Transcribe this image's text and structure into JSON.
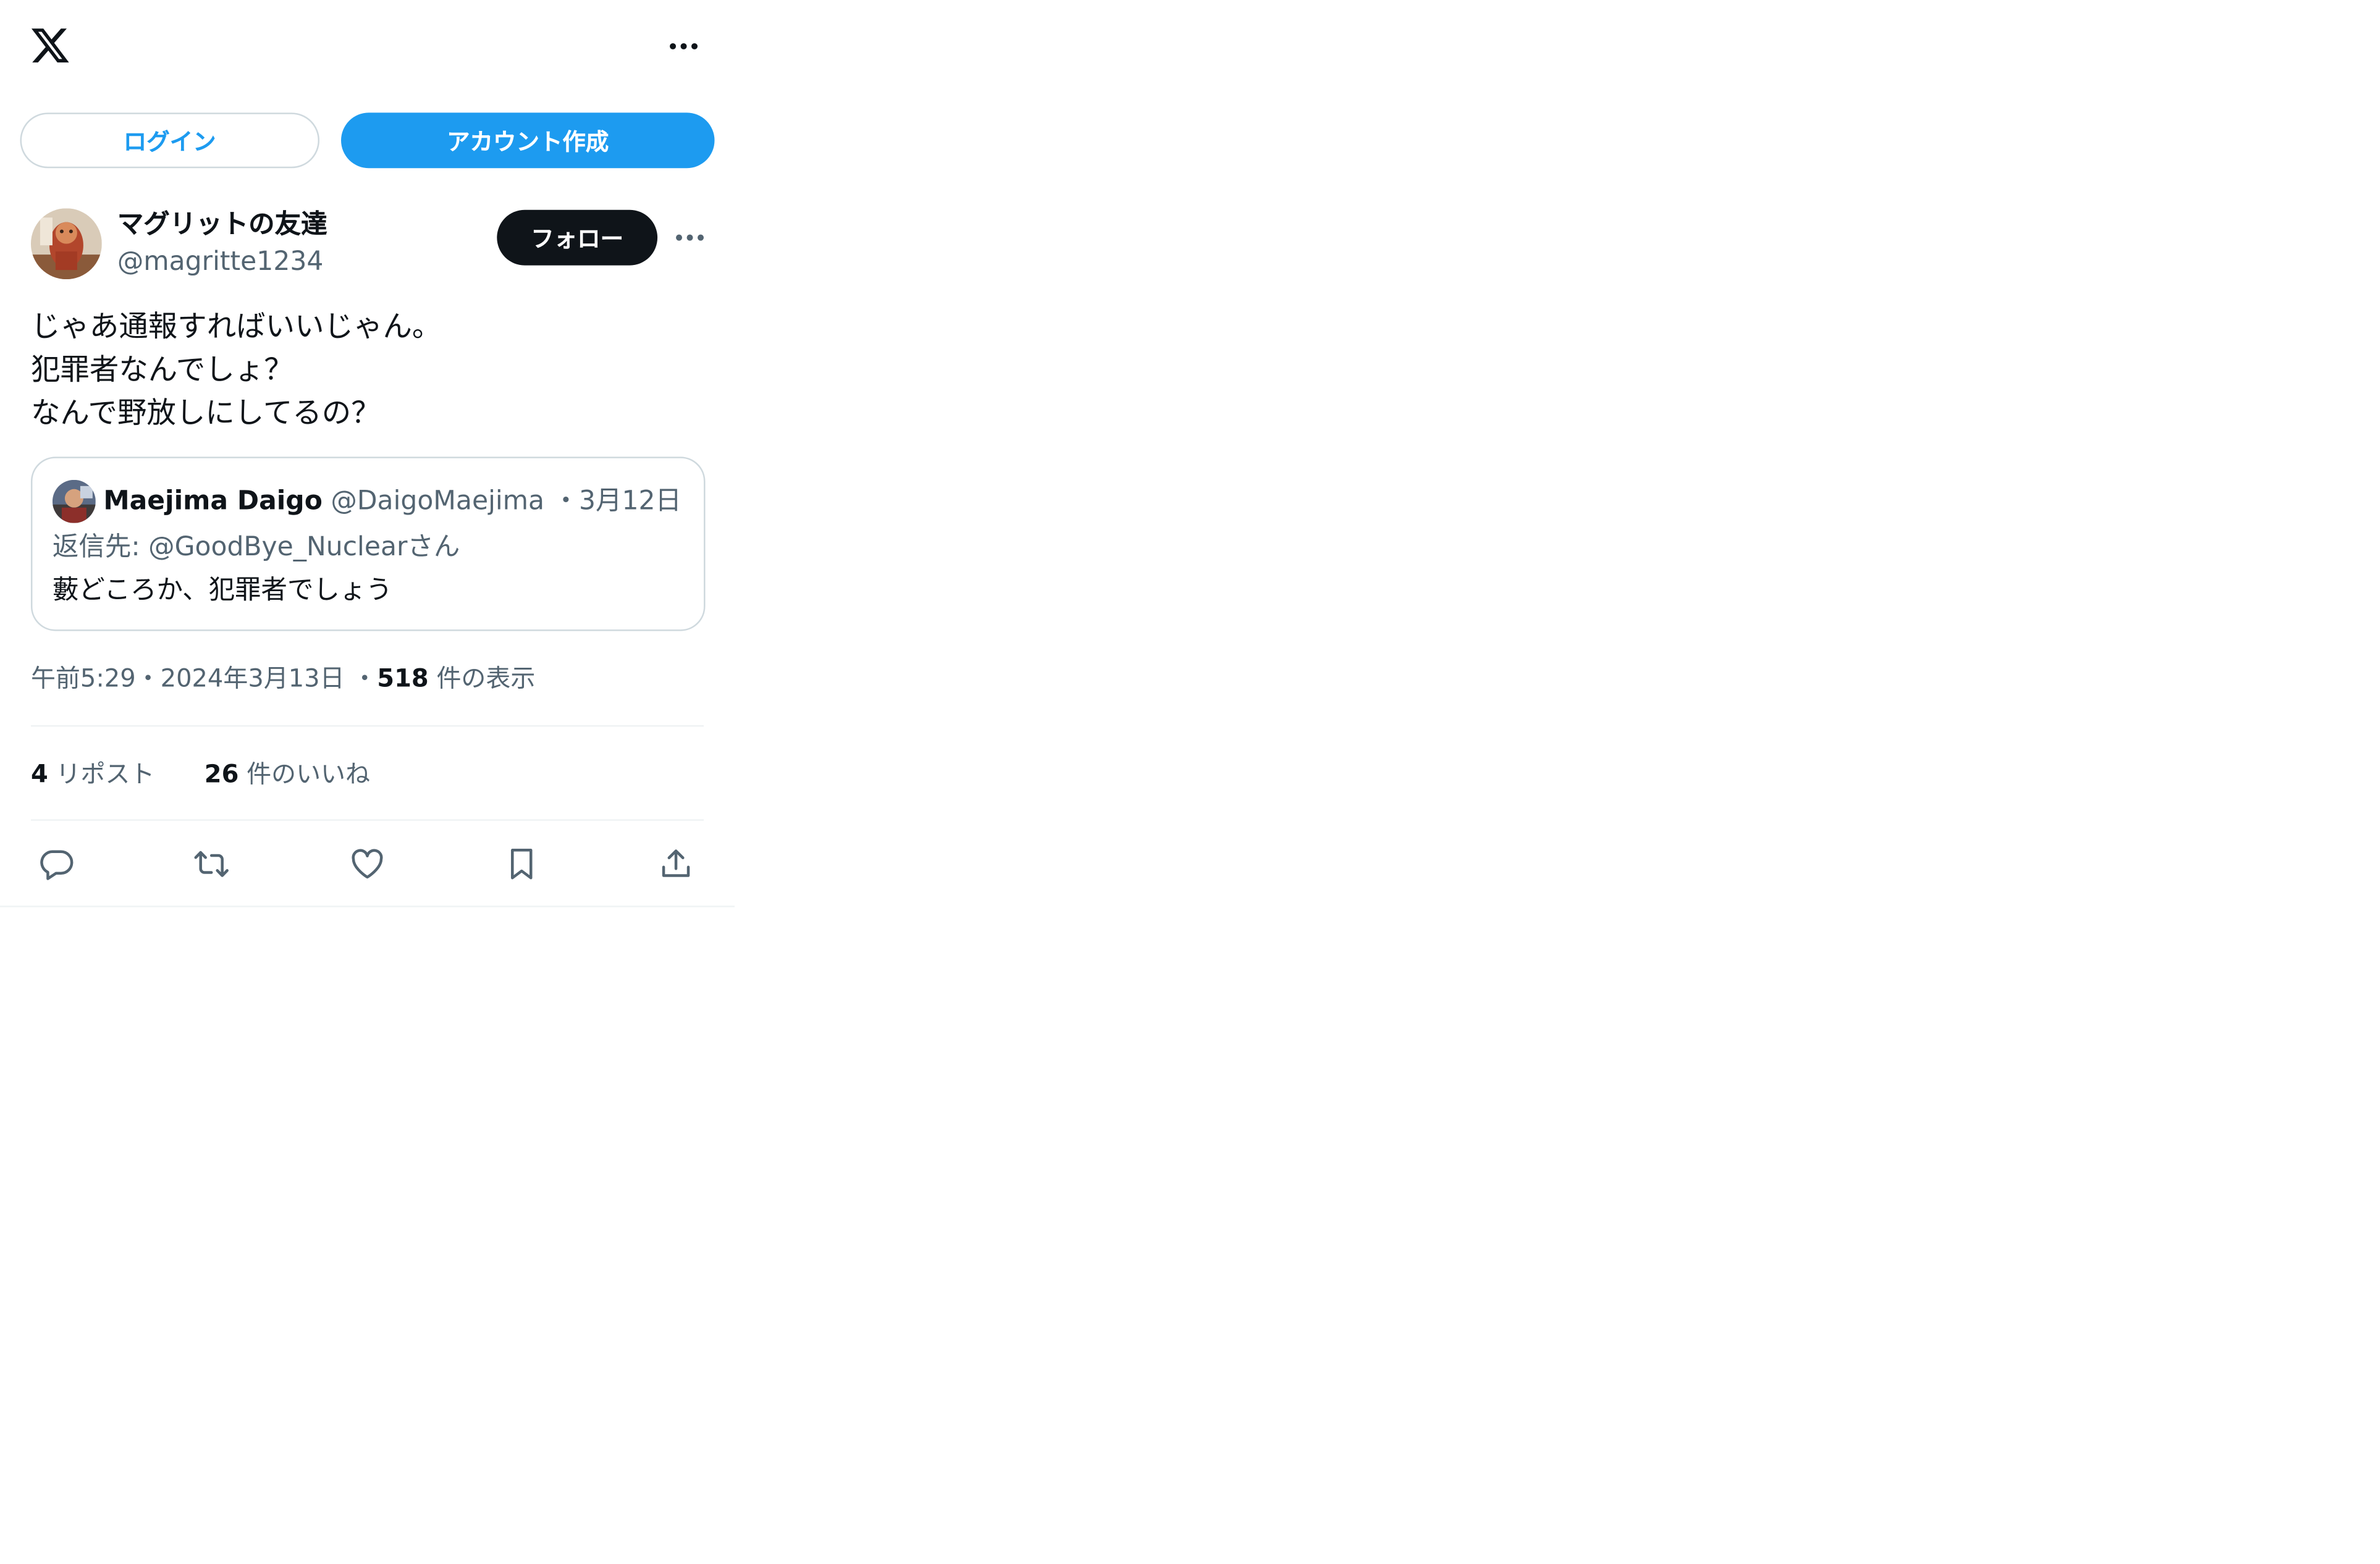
{
  "header": {
    "logo_icon": "x-logo-icon",
    "more_icon": "more-icon"
  },
  "auth": {
    "login_label": "ログイン",
    "signup_label": "アカウント作成"
  },
  "post": {
    "author_name": "マグリットの友達",
    "author_handle": "@magritte1234",
    "follow_label": "フォロー",
    "text_lines": [
      "じゃあ通報すればいいじゃん。",
      "犯罪者なんでしょ？",
      "なんで野放しにしてるの？"
    ],
    "time": "午前5:29",
    "date": "2024年3月13日",
    "views_count": "518",
    "views_label": "件の表示",
    "separator": "・"
  },
  "quote": {
    "author_name": "Maejima Daigo",
    "author_handle": "@DaigoMaejima",
    "date": "3月12日",
    "separator": "・",
    "reply_to": "返信先: @GoodBye_Nuclearさん",
    "text": "藪どころか、犯罪者でしょう"
  },
  "stats": {
    "reposts_count": "4",
    "reposts_label": "リポスト",
    "likes_count": "26",
    "likes_label": "件のいいね"
  },
  "actions": [
    {
      "icon": "reply-icon"
    },
    {
      "icon": "repost-icon"
    },
    {
      "icon": "like-icon"
    },
    {
      "icon": "bookmark-icon"
    },
    {
      "icon": "share-icon"
    }
  ],
  "colors": {
    "accent": "#1d9bf0",
    "text_primary": "#0f1419",
    "text_secondary": "#536471",
    "border": "#cfd9de",
    "divider": "#eff3f4"
  }
}
